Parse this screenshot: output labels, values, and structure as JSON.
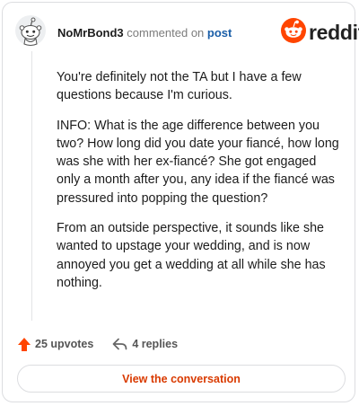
{
  "header": {
    "username": "NoMrBond3",
    "action_text": "commented on",
    "post_link": "post",
    "logo_text": "reddit",
    "logo_icon": "reddit-snoo-icon",
    "avatar_icon": "snoo-avatar-icon"
  },
  "comment": {
    "paragraphs": [
      "You're definitely not the TA but I have a few questions because I'm curious.",
      "INFO: What is the age difference between you two? How long did you date your fiancé, how long was she with her ex-fiancé? She got engaged only a month after you, any idea if the fiancé was pressured into popping the question?",
      "From an outside perspective, it sounds like she wanted to upstage your wedding, and is now annoyed you get a wedding at all while she has nothing."
    ]
  },
  "actions": {
    "upvotes_label": "25 upvotes",
    "replies_label": "4 replies",
    "upvote_icon": "upvote-arrow-icon",
    "reply_icon": "reply-arrow-icon"
  },
  "cta": {
    "label": "View the conversation"
  },
  "colors": {
    "brand": "#ff4500",
    "link": "#1a5ea8",
    "cta_text": "#d93a00"
  }
}
